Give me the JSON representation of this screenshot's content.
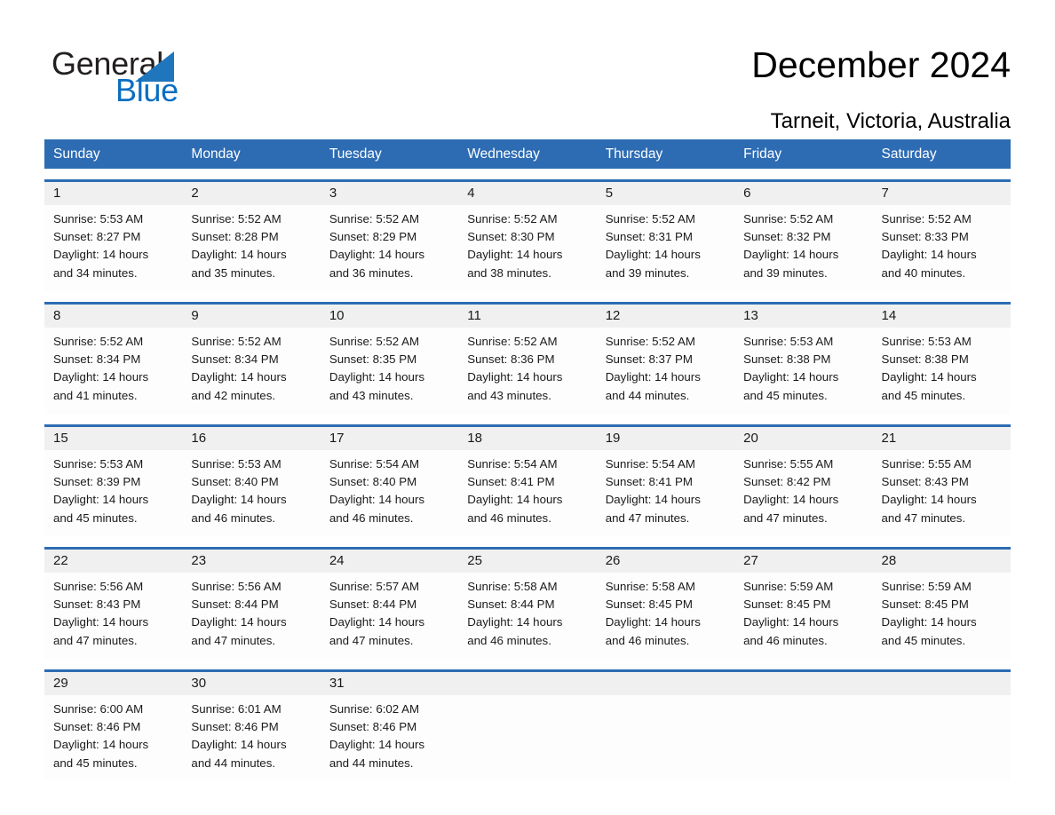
{
  "brand": {
    "name_part1": "General",
    "name_part2": "Blue",
    "triangle_color": "#1f76bc",
    "blue_text_color": "#0a6ec1"
  },
  "header": {
    "title": "December 2024",
    "location": "Tarneit, Victoria, Australia"
  },
  "theme": {
    "header_blue": "#2d6cb3",
    "date_band_gray": "#f0f0f0",
    "cell_white": "#fdfdfd",
    "text_color": "#1a1a1a"
  },
  "weekdays": [
    "Sunday",
    "Monday",
    "Tuesday",
    "Wednesday",
    "Thursday",
    "Friday",
    "Saturday"
  ],
  "weeks": [
    {
      "days": [
        {
          "date": "1",
          "sunrise": "Sunrise: 5:53 AM",
          "sunset": "Sunset: 8:27 PM",
          "daylight_line1": "Daylight: 14 hours",
          "daylight_line2": "and 34 minutes."
        },
        {
          "date": "2",
          "sunrise": "Sunrise: 5:52 AM",
          "sunset": "Sunset: 8:28 PM",
          "daylight_line1": "Daylight: 14 hours",
          "daylight_line2": "and 35 minutes."
        },
        {
          "date": "3",
          "sunrise": "Sunrise: 5:52 AM",
          "sunset": "Sunset: 8:29 PM",
          "daylight_line1": "Daylight: 14 hours",
          "daylight_line2": "and 36 minutes."
        },
        {
          "date": "4",
          "sunrise": "Sunrise: 5:52 AM",
          "sunset": "Sunset: 8:30 PM",
          "daylight_line1": "Daylight: 14 hours",
          "daylight_line2": "and 38 minutes."
        },
        {
          "date": "5",
          "sunrise": "Sunrise: 5:52 AM",
          "sunset": "Sunset: 8:31 PM",
          "daylight_line1": "Daylight: 14 hours",
          "daylight_line2": "and 39 minutes."
        },
        {
          "date": "6",
          "sunrise": "Sunrise: 5:52 AM",
          "sunset": "Sunset: 8:32 PM",
          "daylight_line1": "Daylight: 14 hours",
          "daylight_line2": "and 39 minutes."
        },
        {
          "date": "7",
          "sunrise": "Sunrise: 5:52 AM",
          "sunset": "Sunset: 8:33 PM",
          "daylight_line1": "Daylight: 14 hours",
          "daylight_line2": "and 40 minutes."
        }
      ]
    },
    {
      "days": [
        {
          "date": "8",
          "sunrise": "Sunrise: 5:52 AM",
          "sunset": "Sunset: 8:34 PM",
          "daylight_line1": "Daylight: 14 hours",
          "daylight_line2": "and 41 minutes."
        },
        {
          "date": "9",
          "sunrise": "Sunrise: 5:52 AM",
          "sunset": "Sunset: 8:34 PM",
          "daylight_line1": "Daylight: 14 hours",
          "daylight_line2": "and 42 minutes."
        },
        {
          "date": "10",
          "sunrise": "Sunrise: 5:52 AM",
          "sunset": "Sunset: 8:35 PM",
          "daylight_line1": "Daylight: 14 hours",
          "daylight_line2": "and 43 minutes."
        },
        {
          "date": "11",
          "sunrise": "Sunrise: 5:52 AM",
          "sunset": "Sunset: 8:36 PM",
          "daylight_line1": "Daylight: 14 hours",
          "daylight_line2": "and 43 minutes."
        },
        {
          "date": "12",
          "sunrise": "Sunrise: 5:52 AM",
          "sunset": "Sunset: 8:37 PM",
          "daylight_line1": "Daylight: 14 hours",
          "daylight_line2": "and 44 minutes."
        },
        {
          "date": "13",
          "sunrise": "Sunrise: 5:53 AM",
          "sunset": "Sunset: 8:38 PM",
          "daylight_line1": "Daylight: 14 hours",
          "daylight_line2": "and 45 minutes."
        },
        {
          "date": "14",
          "sunrise": "Sunrise: 5:53 AM",
          "sunset": "Sunset: 8:38 PM",
          "daylight_line1": "Daylight: 14 hours",
          "daylight_line2": "and 45 minutes."
        }
      ]
    },
    {
      "days": [
        {
          "date": "15",
          "sunrise": "Sunrise: 5:53 AM",
          "sunset": "Sunset: 8:39 PM",
          "daylight_line1": "Daylight: 14 hours",
          "daylight_line2": "and 45 minutes."
        },
        {
          "date": "16",
          "sunrise": "Sunrise: 5:53 AM",
          "sunset": "Sunset: 8:40 PM",
          "daylight_line1": "Daylight: 14 hours",
          "daylight_line2": "and 46 minutes."
        },
        {
          "date": "17",
          "sunrise": "Sunrise: 5:54 AM",
          "sunset": "Sunset: 8:40 PM",
          "daylight_line1": "Daylight: 14 hours",
          "daylight_line2": "and 46 minutes."
        },
        {
          "date": "18",
          "sunrise": "Sunrise: 5:54 AM",
          "sunset": "Sunset: 8:41 PM",
          "daylight_line1": "Daylight: 14 hours",
          "daylight_line2": "and 46 minutes."
        },
        {
          "date": "19",
          "sunrise": "Sunrise: 5:54 AM",
          "sunset": "Sunset: 8:41 PM",
          "daylight_line1": "Daylight: 14 hours",
          "daylight_line2": "and 47 minutes."
        },
        {
          "date": "20",
          "sunrise": "Sunrise: 5:55 AM",
          "sunset": "Sunset: 8:42 PM",
          "daylight_line1": "Daylight: 14 hours",
          "daylight_line2": "and 47 minutes."
        },
        {
          "date": "21",
          "sunrise": "Sunrise: 5:55 AM",
          "sunset": "Sunset: 8:43 PM",
          "daylight_line1": "Daylight: 14 hours",
          "daylight_line2": "and 47 minutes."
        }
      ]
    },
    {
      "days": [
        {
          "date": "22",
          "sunrise": "Sunrise: 5:56 AM",
          "sunset": "Sunset: 8:43 PM",
          "daylight_line1": "Daylight: 14 hours",
          "daylight_line2": "and 47 minutes."
        },
        {
          "date": "23",
          "sunrise": "Sunrise: 5:56 AM",
          "sunset": "Sunset: 8:44 PM",
          "daylight_line1": "Daylight: 14 hours",
          "daylight_line2": "and 47 minutes."
        },
        {
          "date": "24",
          "sunrise": "Sunrise: 5:57 AM",
          "sunset": "Sunset: 8:44 PM",
          "daylight_line1": "Daylight: 14 hours",
          "daylight_line2": "and 47 minutes."
        },
        {
          "date": "25",
          "sunrise": "Sunrise: 5:58 AM",
          "sunset": "Sunset: 8:44 PM",
          "daylight_line1": "Daylight: 14 hours",
          "daylight_line2": "and 46 minutes."
        },
        {
          "date": "26",
          "sunrise": "Sunrise: 5:58 AM",
          "sunset": "Sunset: 8:45 PM",
          "daylight_line1": "Daylight: 14 hours",
          "daylight_line2": "and 46 minutes."
        },
        {
          "date": "27",
          "sunrise": "Sunrise: 5:59 AM",
          "sunset": "Sunset: 8:45 PM",
          "daylight_line1": "Daylight: 14 hours",
          "daylight_line2": "and 46 minutes."
        },
        {
          "date": "28",
          "sunrise": "Sunrise: 5:59 AM",
          "sunset": "Sunset: 8:45 PM",
          "daylight_line1": "Daylight: 14 hours",
          "daylight_line2": "and 45 minutes."
        }
      ]
    },
    {
      "days": [
        {
          "date": "29",
          "sunrise": "Sunrise: 6:00 AM",
          "sunset": "Sunset: 8:46 PM",
          "daylight_line1": "Daylight: 14 hours",
          "daylight_line2": "and 45 minutes."
        },
        {
          "date": "30",
          "sunrise": "Sunrise: 6:01 AM",
          "sunset": "Sunset: 8:46 PM",
          "daylight_line1": "Daylight: 14 hours",
          "daylight_line2": "and 44 minutes."
        },
        {
          "date": "31",
          "sunrise": "Sunrise: 6:02 AM",
          "sunset": "Sunset: 8:46 PM",
          "daylight_line1": "Daylight: 14 hours",
          "daylight_line2": "and 44 minutes."
        },
        {
          "date": "",
          "sunrise": "",
          "sunset": "",
          "daylight_line1": "",
          "daylight_line2": ""
        },
        {
          "date": "",
          "sunrise": "",
          "sunset": "",
          "daylight_line1": "",
          "daylight_line2": ""
        },
        {
          "date": "",
          "sunrise": "",
          "sunset": "",
          "daylight_line1": "",
          "daylight_line2": ""
        },
        {
          "date": "",
          "sunrise": "",
          "sunset": "",
          "daylight_line1": "",
          "daylight_line2": ""
        }
      ]
    }
  ]
}
